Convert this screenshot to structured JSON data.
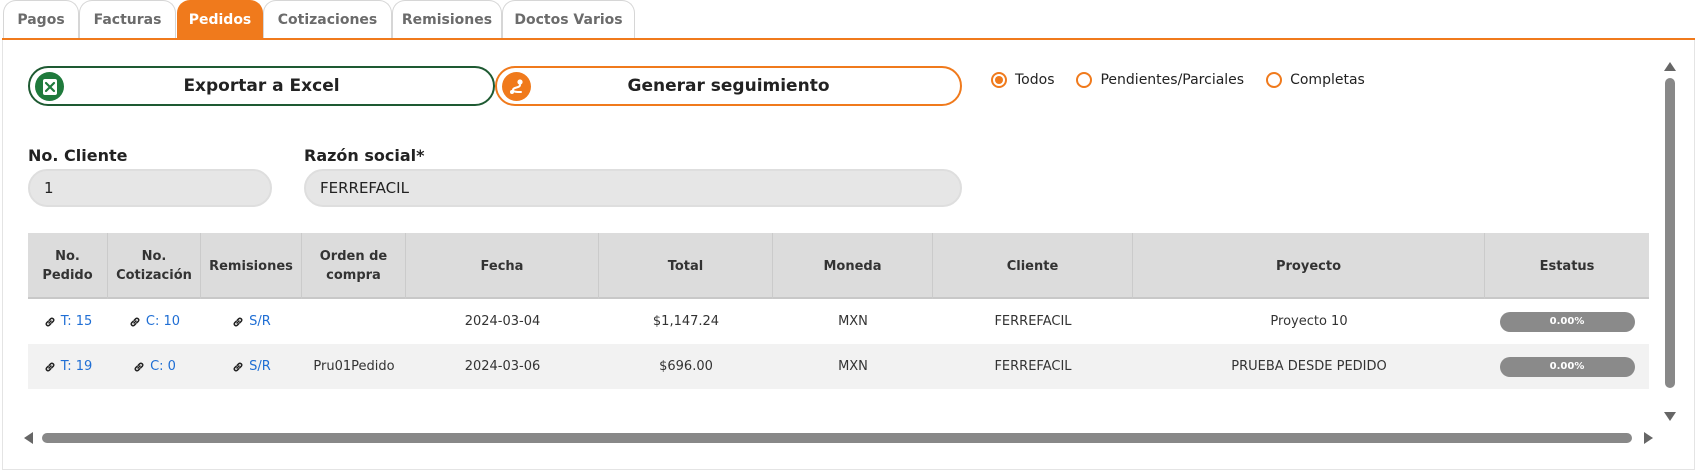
{
  "tabs": [
    {
      "label": "Pagos"
    },
    {
      "label": "Facturas"
    },
    {
      "label": "Pedidos",
      "active": true
    },
    {
      "label": "Cotizaciones"
    },
    {
      "label": "Remisiones"
    },
    {
      "label": "Doctos Varios"
    }
  ],
  "actions": {
    "export_label": "Exportar a Excel",
    "export_icon": "excel-icon",
    "seguimiento_label": "Generar seguimiento",
    "seguimiento_icon": "route-icon"
  },
  "filters": {
    "options": [
      "Todos",
      "Pendientes/Parciales",
      "Completas"
    ],
    "selected": "Todos"
  },
  "form": {
    "cliente_label": "No. Cliente",
    "cliente_value": "1",
    "razon_label": "Razón social*",
    "razon_value": "FERREFACIL"
  },
  "table": {
    "headers": [
      "No. Pedido",
      "No. Cotización",
      "Remisiones",
      "Orden de compra",
      "Fecha",
      "Total",
      "Moneda",
      "Cliente",
      "Proyecto",
      "Estatus"
    ],
    "rows": [
      {
        "pedido": "T: 15",
        "cotizacion": "C: 10",
        "remisiones": "S/R",
        "orden": "",
        "fecha": "2024-03-04",
        "total": "$1,147.24",
        "moneda": "MXN",
        "cliente": "FERREFACIL",
        "proyecto": "Proyecto 10",
        "estatus": "0.00%"
      },
      {
        "pedido": "T: 19",
        "cotizacion": "C: 0",
        "remisiones": "S/R",
        "orden": "Pru01Pedido",
        "fecha": "2024-03-06",
        "total": "$696.00",
        "moneda": "MXN",
        "cliente": "FERREFACIL",
        "proyecto": "PRUEBA DESDE PEDIDO",
        "estatus": "0.00%"
      }
    ]
  },
  "colors": {
    "accent": "#f07a1c",
    "excel_green": "#1e5a32",
    "link": "#1f6ed4",
    "status_pill": "#8a8a8a"
  }
}
